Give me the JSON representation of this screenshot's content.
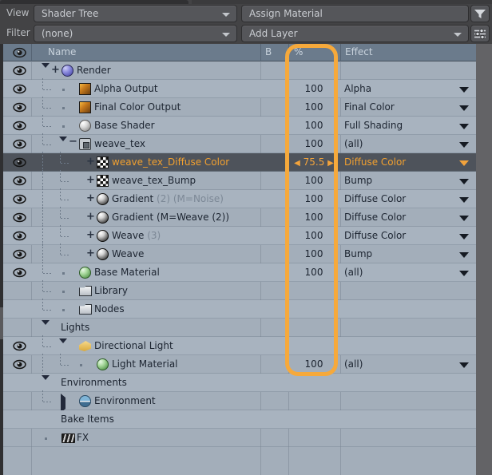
{
  "toolbar": {
    "view_label": "View",
    "view_value": "Shader Tree",
    "filter_label": "Filter",
    "filter_value": "(none)",
    "assign_value": "Assign Material",
    "add_layer_value": "Add Layer",
    "filter_icon": "funnel-icon",
    "settings_icon": "sliders-icon"
  },
  "columns": {
    "visibility": "",
    "name": "Name",
    "blend": "B",
    "percent": "%",
    "effect": "Effect"
  },
  "annotation": {
    "color": "#f6a93b",
    "target": "percent-column"
  },
  "rows": [
    {
      "eye": true,
      "indent": 0,
      "name": "Render",
      "percent": "",
      "effect": "",
      "expander": "down",
      "plus": true,
      "icon": "sphere-blue-icon"
    },
    {
      "eye": true,
      "indent": 1,
      "name": "Alpha Output",
      "percent": "100",
      "effect": "Alpha",
      "expander": "none",
      "plus": false,
      "icon": "image-output-icon"
    },
    {
      "eye": true,
      "indent": 1,
      "name": "Final Color Output",
      "percent": "100",
      "effect": "Final Color",
      "expander": "none",
      "plus": false,
      "icon": "image-output-icon"
    },
    {
      "eye": true,
      "indent": 1,
      "name": "Base Shader",
      "percent": "100",
      "effect": "Full Shading",
      "expander": "none",
      "plus": false,
      "icon": "sphere-gray-icon"
    },
    {
      "eye": true,
      "indent": 1,
      "name": "weave_tex",
      "percent": "100",
      "effect": "(all)",
      "expander": "down",
      "plus": false,
      "minus": true,
      "icon": "folder-group-icon"
    },
    {
      "eye": true,
      "indent": 2,
      "name": "weave_tex_Diffuse Color",
      "percent": "75.5",
      "effect": "Diffuse Color",
      "expander": "none",
      "plus": true,
      "icon": "checker-texture-icon",
      "selected": true,
      "spinner": true
    },
    {
      "eye": true,
      "indent": 2,
      "name": "weave_tex_Bump",
      "percent": "100",
      "effect": "Bump",
      "expander": "none",
      "plus": true,
      "icon": "checker-texture-icon"
    },
    {
      "eye": true,
      "indent": 2,
      "name": "Gradient",
      "name_dim": " (2) (M=Noise)",
      "percent": "100",
      "effect": "Diffuse Color",
      "expander": "none",
      "plus": true,
      "icon": "sphere-texture-icon"
    },
    {
      "eye": true,
      "indent": 2,
      "name": "Gradient (M=Weave (2))",
      "percent": "100",
      "effect": "Diffuse Color",
      "expander": "none",
      "plus": true,
      "icon": "sphere-texture-icon"
    },
    {
      "eye": true,
      "indent": 2,
      "name": "Weave",
      "name_dim": " (3)",
      "percent": "100",
      "effect": "Diffuse Color",
      "expander": "none",
      "plus": true,
      "icon": "sphere-texture-icon"
    },
    {
      "eye": true,
      "indent": 2,
      "name": "Weave",
      "percent": "100",
      "effect": "Bump",
      "expander": "none",
      "plus": true,
      "icon": "sphere-texture-icon"
    },
    {
      "eye": true,
      "indent": 1,
      "name": "Base Material",
      "percent": "100",
      "effect": "(all)",
      "expander": "none",
      "plus": false,
      "icon": "sphere-green-icon"
    },
    {
      "eye": false,
      "indent": 1,
      "name": "Library",
      "percent": "",
      "effect": "",
      "expander": "none",
      "plus": false,
      "icon": "folder-icon"
    },
    {
      "eye": false,
      "indent": 1,
      "name": "Nodes",
      "percent": "",
      "effect": "",
      "expander": "none",
      "plus": false,
      "icon": "folder-icon"
    },
    {
      "eye": false,
      "indent": 0,
      "name": "Lights",
      "percent": "",
      "effect": "",
      "expander": "down",
      "plus": false,
      "icon": "none"
    },
    {
      "eye": true,
      "indent": 1,
      "name": "Directional Light",
      "percent": "",
      "effect": "",
      "expander": "down",
      "plus": false,
      "icon": "light-icon"
    },
    {
      "eye": true,
      "indent": 2,
      "name": "Light Material",
      "percent": "100",
      "effect": "(all)",
      "expander": "none",
      "plus": false,
      "icon": "sphere-green-icon"
    },
    {
      "eye": false,
      "indent": 0,
      "name": "Environments",
      "percent": "",
      "effect": "",
      "expander": "down",
      "plus": false,
      "icon": "none"
    },
    {
      "eye": false,
      "indent": 1,
      "name": "Environment",
      "percent": "",
      "effect": "",
      "expander": "right",
      "plus": false,
      "icon": "environment-icon"
    },
    {
      "eye": false,
      "indent": 0,
      "name": "Bake Items",
      "percent": "",
      "effect": "",
      "expander": "none",
      "plus": false,
      "icon": "none"
    },
    {
      "eye": false,
      "indent": 0,
      "name": "FX",
      "percent": "",
      "effect": "",
      "expander": "none",
      "plus": false,
      "icon": "fx-icon"
    }
  ]
}
